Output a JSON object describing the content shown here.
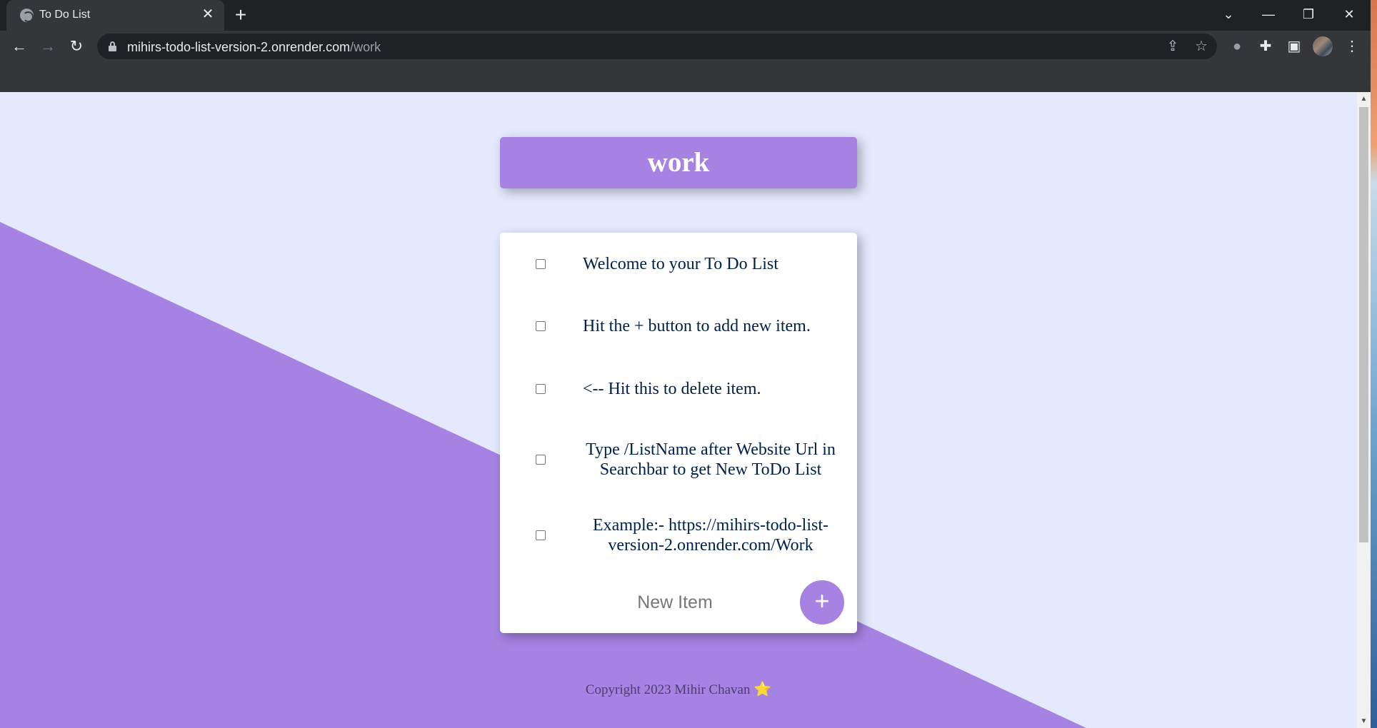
{
  "browser": {
    "tab_title": "To Do List",
    "tab_close": "✕",
    "new_tab": "+",
    "url_host": "mihirs-todo-list-version-2.onrender.com",
    "url_path": "/work",
    "icons": {
      "back": "back-arrow-icon",
      "forward": "forward-arrow-icon",
      "reload": "reload-icon",
      "share": "share-icon",
      "bookmark": "star-icon",
      "extension1": "extension-icon",
      "puzzle": "puzzle-icon",
      "sidepanel": "side-panel-icon",
      "menu": "kebab-menu-icon"
    }
  },
  "page": {
    "heading": "work",
    "items": [
      {
        "text": "Welcome to your To Do List",
        "checked": false
      },
      {
        "text": "Hit the + button to add new item.",
        "checked": false
      },
      {
        "text": "<-- Hit this to delete item.",
        "checked": false
      },
      {
        "text": "Type /ListName after Website Url in Searchbar to get New ToDo List",
        "checked": false
      },
      {
        "text": "Example:- https://mihirs-todo-list-version-2.onrender.com/Work",
        "checked": false
      }
    ],
    "new_item_placeholder": "New Item",
    "add_button_label": "+",
    "footer": "Copyright 2023 Mihir Chavan",
    "footer_emoji": "⭐"
  },
  "colors": {
    "accent_purple": "#a683e3",
    "background": "#e4e9fd",
    "text_navy": "#00204a"
  }
}
